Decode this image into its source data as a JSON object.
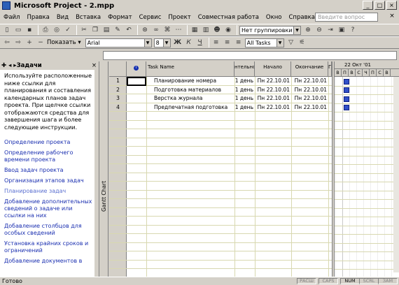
{
  "window": {
    "title": "Microsoft Project - 2.mpp"
  },
  "menu": {
    "items": [
      "Файл",
      "Правка",
      "Вид",
      "Вставка",
      "Формат",
      "Сервис",
      "Проект",
      "Совместная работа",
      "Окно",
      "Справка"
    ],
    "ask_placeholder": "Введите вопрос"
  },
  "toolbar1": {
    "grouping": "Нет группировки"
  },
  "toolbar2": {
    "show_label": "Показать",
    "font": "Arial",
    "size": "8",
    "bold": "Ж",
    "italic": "К",
    "underline": "Ч",
    "filter": "All Tasks"
  },
  "tasks_pane": {
    "title": "Задачи",
    "intro": "Используйте расположенные ниже ссылки для планирования и составления календарных планов задач проекта. При щелчке ссылки отображаются средства для завершения шага и более следующие инструкции.",
    "links": [
      "Определение проекта",
      "Определение рабочего времени проекта",
      "Ввод задач проекта",
      "Организация этапов задач",
      "Планирование задач",
      "Добавление дополнительных сведений о задаче или ссылки на них",
      "Добавление столбцов для особых сведений",
      "Установка крайних сроков и ограничений",
      "Добавление документов в"
    ]
  },
  "view_bar": {
    "label": "Gantt Chart"
  },
  "table": {
    "headers": {
      "info": "i",
      "name": "Task Name",
      "duration": "нтельнос",
      "start": "Начало",
      "finish": "Окончание",
      "extra": "Г"
    },
    "rows": [
      {
        "id": "1",
        "name": "Планирование номера",
        "duration": "1 день",
        "start": "Пн 22.10.01",
        "finish": "Пн 22.10.01"
      },
      {
        "id": "2",
        "name": "Подготовка материалов",
        "duration": "1 день",
        "start": "Пн 22.10.01",
        "finish": "Пн 22.10.01"
      },
      {
        "id": "3",
        "name": "Верстка журнала",
        "duration": "1 день",
        "start": "Пн 22.10.01",
        "finish": "Пн 22.10.01"
      },
      {
        "id": "4",
        "name": "Предпечатная подготовка",
        "duration": "1 день",
        "start": "Пн 22.10.01",
        "finish": "Пн 22.10.01"
      }
    ]
  },
  "gantt": {
    "week_label": "22 Окт '01",
    "days": [
      "В",
      "П",
      "В",
      "С",
      "Ч",
      "П",
      "С",
      "В"
    ]
  },
  "status": {
    "ready": "Готово",
    "indicators": [
      "РАСШ",
      "CAPS",
      "NUM",
      "SCRL",
      "ЗАМ"
    ],
    "active_indicator": "NUM"
  },
  "colors": {
    "link": "#1a2fb0",
    "milestone": "#3050c8",
    "gridline": "#d8d8b0"
  }
}
